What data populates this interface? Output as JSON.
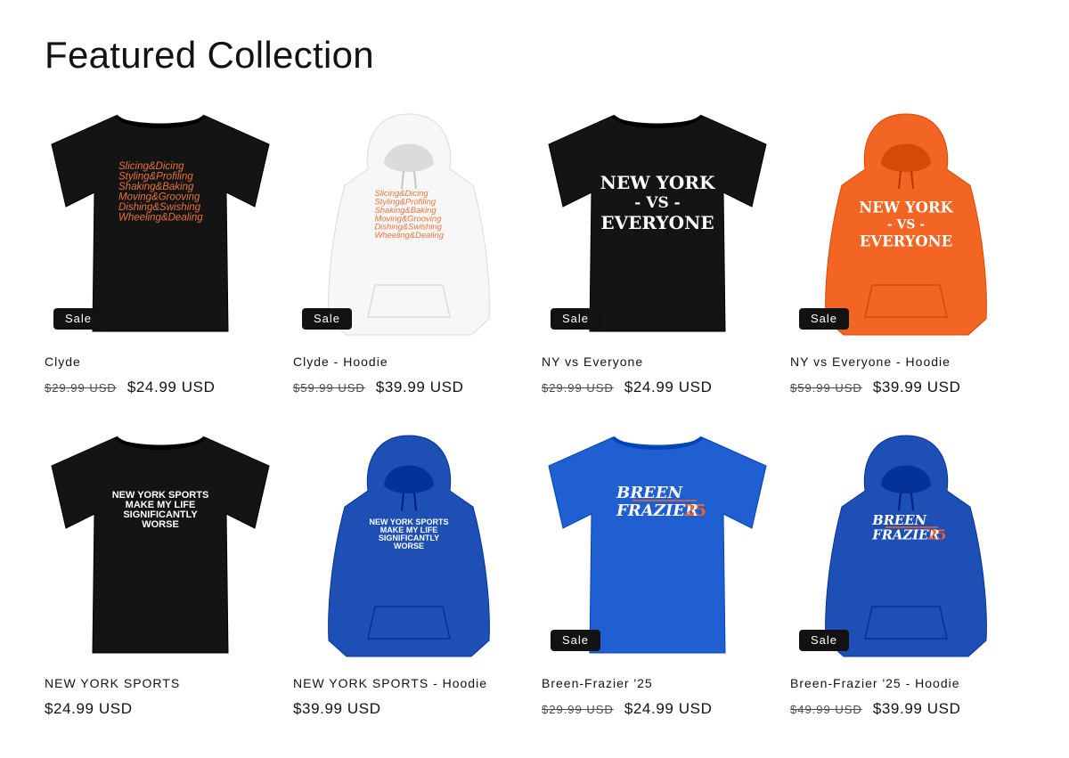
{
  "section": {
    "title": "Featured Collection"
  },
  "products": [
    {
      "title": "Clyde",
      "badge": "Sale",
      "compare_price": "$29.99 USD",
      "price": "$24.99 USD",
      "garment": "tshirt",
      "color": "#141414",
      "print_color": "#e8733a",
      "print_lines": [
        "Slicing&Dicing",
        "Styling&Profiling",
        "Shaking&Baking",
        "Moving&Grooving",
        "Dishing&Swishing",
        "Wheeling&Dealing"
      ],
      "print_style": "italic"
    },
    {
      "title": "Clyde - Hoodie",
      "badge": "Sale",
      "compare_price": "$59.99 USD",
      "price": "$39.99 USD",
      "garment": "hoodie",
      "color": "#f7f7f7",
      "print_color": "#e8733a",
      "print_lines": [
        "Slicing&Dicing",
        "Styling&Profiling",
        "Shaking&Baking",
        "Moving&Grooving",
        "Dishing&Swishing",
        "Wheeling&Dealing"
      ],
      "print_style": "italic"
    },
    {
      "title": "NY vs Everyone",
      "badge": "Sale",
      "compare_price": "$29.99 USD",
      "price": "$24.99 USD",
      "garment": "tshirt",
      "color": "#141414",
      "print_color": "#ffffff",
      "print_lines": [
        "NEW YORK",
        "- VS -",
        "EVERYONE"
      ],
      "print_style": "varsity"
    },
    {
      "title": "NY vs Everyone - Hoodie",
      "badge": "Sale",
      "compare_price": "$59.99 USD",
      "price": "$39.99 USD",
      "garment": "hoodie",
      "color": "#f26522",
      "print_color": "#ffffff",
      "print_lines": [
        "NEW YORK",
        "- VS -",
        "EVERYONE"
      ],
      "print_style": "varsity"
    },
    {
      "title": "NEW YORK SPORTS",
      "badge": "",
      "compare_price": "",
      "price": "$24.99 USD",
      "garment": "tshirt",
      "color": "#141414",
      "print_color": "#ffffff",
      "print_lines": [
        "NEW YORK SPORTS",
        "MAKE MY LIFE",
        "SIGNIFICANTLY",
        "WORSE"
      ],
      "print_style": "block"
    },
    {
      "title": "NEW YORK SPORTS - Hoodie",
      "badge": "",
      "compare_price": "",
      "price": "$39.99 USD",
      "garment": "hoodie",
      "color": "#1d4fb4",
      "print_color": "#ffffff",
      "print_lines": [
        "NEW YORK SPORTS",
        "MAKE MY LIFE",
        "SIGNIFICANTLY",
        "WORSE"
      ],
      "print_style": "block"
    },
    {
      "title": "Breen-Frazier '25",
      "badge": "Sale",
      "compare_price": "$29.99 USD",
      "price": "$24.99 USD",
      "garment": "tshirt",
      "color": "#1f5fd1",
      "print_color": "#ffffff",
      "accent_color": "#f26522",
      "print_lines": [
        "BREEN",
        "FRAZIER",
        "25"
      ],
      "print_style": "campaign"
    },
    {
      "title": "Breen-Frazier '25 - Hoodie",
      "badge": "Sale",
      "compare_price": "$49.99 USD",
      "price": "$39.99 USD",
      "garment": "hoodie",
      "color": "#1d4fb4",
      "print_color": "#ffffff",
      "accent_color": "#f26522",
      "print_lines": [
        "BREEN",
        "FRAZIER",
        "25"
      ],
      "print_style": "campaign"
    }
  ]
}
